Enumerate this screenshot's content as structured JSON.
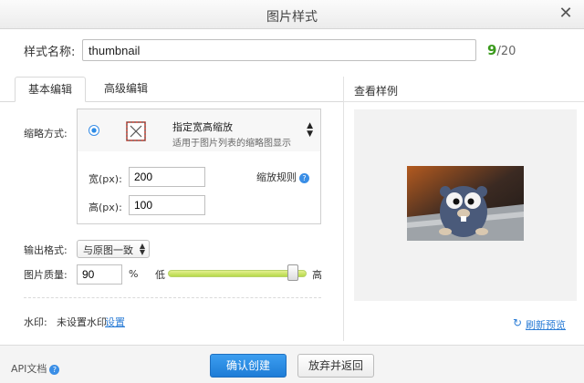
{
  "dialog": {
    "title": "图片样式",
    "close_icon": "close-icon"
  },
  "style_name": {
    "label": "样式名称:",
    "value": "thumbnail",
    "count": "9",
    "max": "/20"
  },
  "tabs": [
    {
      "label": "基本编辑",
      "active": true
    },
    {
      "label": "高级编辑",
      "active": false
    }
  ],
  "preview": {
    "heading": "查看样例",
    "refresh_label": "刷新预览"
  },
  "scale": {
    "label": "缩略方式:",
    "mode_title": "指定宽高缩放",
    "mode_desc": "适用于图片列表的缩略图显示",
    "width_label": "宽(px):",
    "width_value": "200",
    "height_label": "高(px):",
    "height_value": "100",
    "rule_label": "缩放规则",
    "help_icon": "?"
  },
  "output": {
    "label": "输出格式:",
    "selected": "与原图一致"
  },
  "quality": {
    "label": "图片质量:",
    "value": "90",
    "unit": "%",
    "low": "低",
    "high": "高",
    "level": 0.9
  },
  "watermark": {
    "label": "水印:",
    "value": "未设置水印",
    "link": "设置"
  },
  "footer": {
    "api_label": "API文档",
    "confirm": "确认创建",
    "cancel": "放弃并返回"
  },
  "colors": {
    "accent": "#1e7cd6",
    "counter": "#3a9a1c",
    "slider": "#b7d94a"
  }
}
